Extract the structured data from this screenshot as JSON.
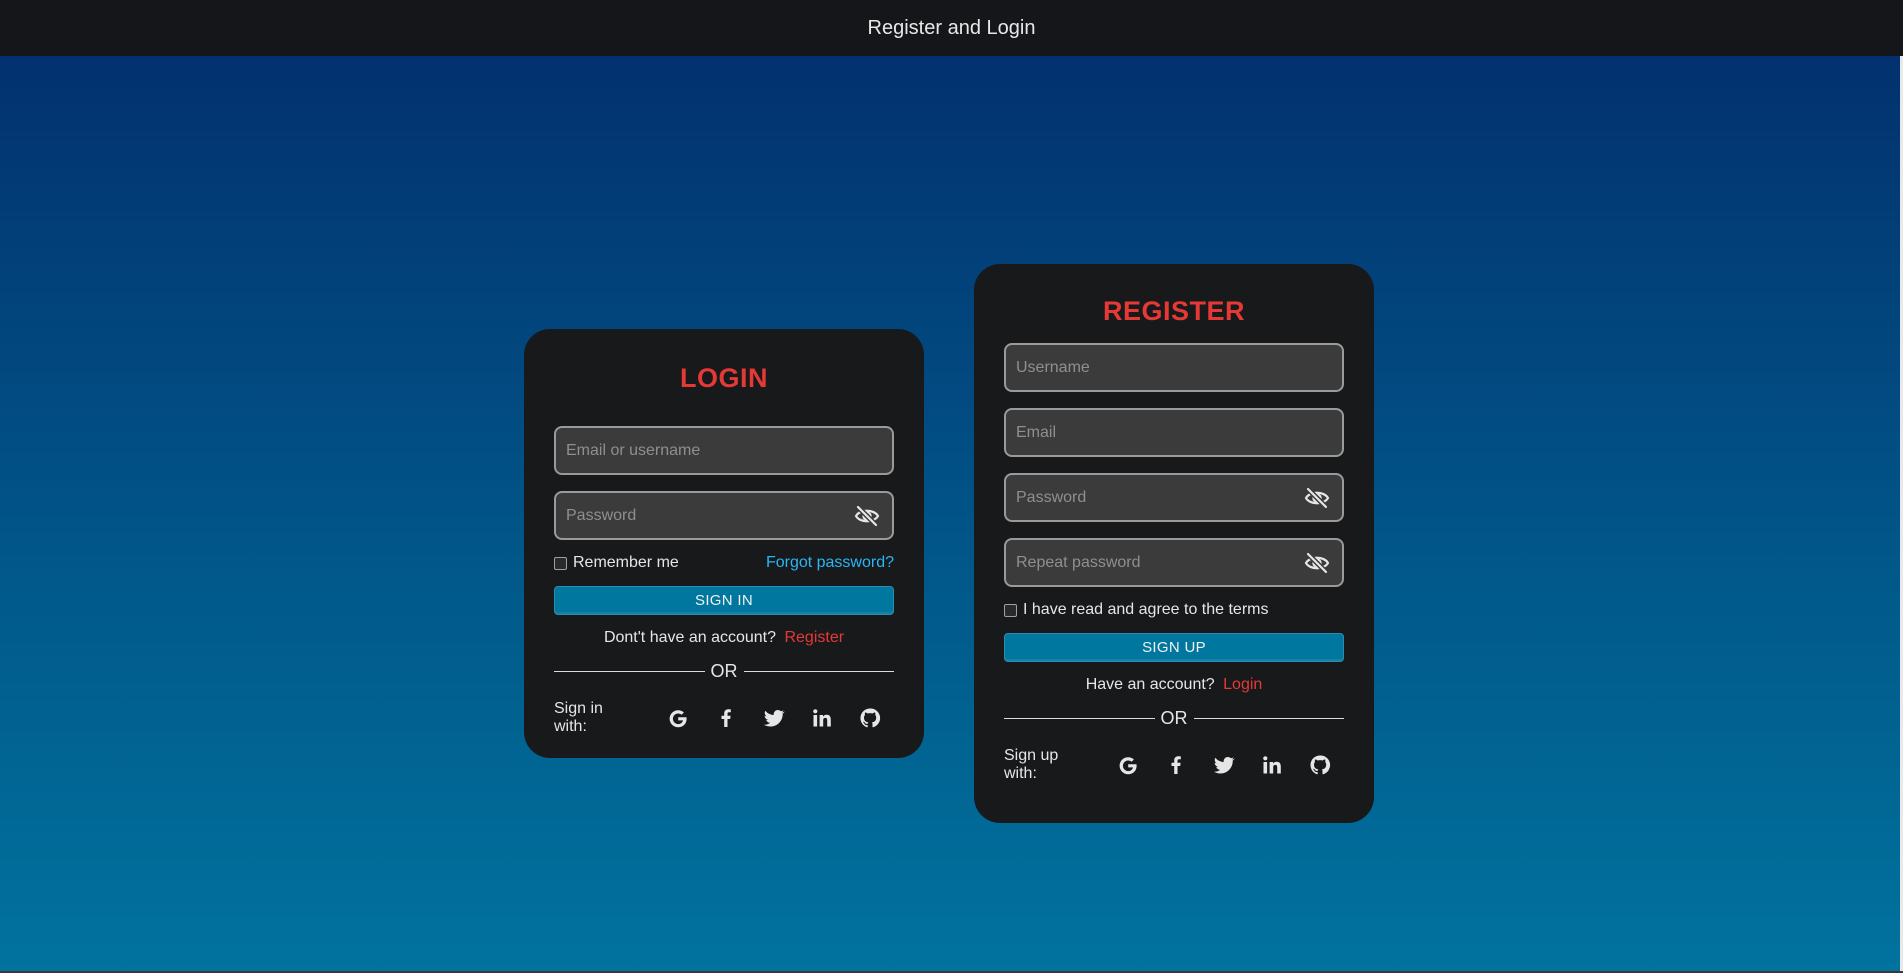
{
  "app": {
    "title": "Register and Login"
  },
  "colors": {
    "accent_red": "#e53935",
    "accent_blue": "#29b6f6",
    "button": "#00779e",
    "card": "#18191b"
  },
  "login": {
    "title": "LOGIN",
    "username_placeholder": "Email or username",
    "password_placeholder": "Password",
    "remember_label": "Remember me",
    "forgot_label": "Forgot password?",
    "submit_label": "SIGN IN",
    "switch_text": "Dont't have an account?",
    "switch_link": "Register",
    "divider_text": "OR",
    "social_label": "Sign in with:",
    "social_icons": [
      "google-icon",
      "facebook-icon",
      "twitter-icon",
      "linkedin-icon",
      "github-icon"
    ]
  },
  "register": {
    "title": "REGISTER",
    "username_placeholder": "Username",
    "email_placeholder": "Email",
    "password_placeholder": "Password",
    "repeat_password_placeholder": "Repeat password",
    "terms_label": "I have read and agree to the terms",
    "submit_label": "SIGN UP",
    "switch_text": "Have an account?",
    "switch_link": "Login",
    "divider_text": "OR",
    "social_label": "Sign up with:",
    "social_icons": [
      "google-icon",
      "facebook-icon",
      "twitter-icon",
      "linkedin-icon",
      "github-icon"
    ]
  }
}
